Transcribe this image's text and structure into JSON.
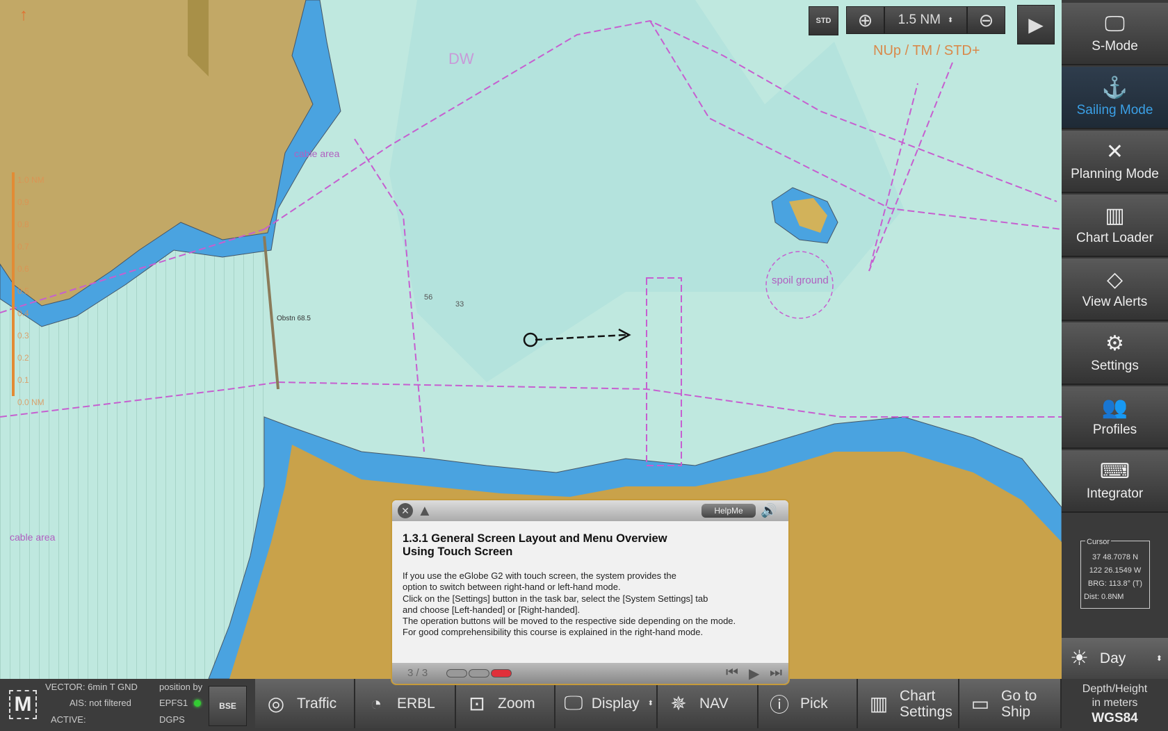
{
  "toolbar": {
    "chart_type": "STD",
    "range": "1.5 NM",
    "orientation_mode": "NUp / TM / STD+"
  },
  "map": {
    "range_scale": {
      "top": "1.0 NM",
      "ticks": [
        "0.9",
        "0.8",
        "0.7",
        "0.6",
        "0.5",
        "0.4",
        "0.3",
        "0.2",
        "0.1"
      ],
      "bottom": "0.0 NM"
    },
    "labels": {
      "cable_area_1": "cable area",
      "cable_area_2": "cable area",
      "spoil_ground": "spoil ground",
      "dw": "DW",
      "obstruction": "Obstn 68.5",
      "depth_1": "33",
      "depth_2": "56"
    }
  },
  "sidebar": {
    "items": [
      {
        "label": "S-Mode",
        "icon": "monitor-icon"
      },
      {
        "label": "Sailing Mode",
        "icon": "anchor-icon",
        "active": true
      },
      {
        "label": "Planning Mode",
        "icon": "tools-icon"
      },
      {
        "label": "Chart Loader",
        "icon": "chart-map-icon"
      },
      {
        "label": "View Alerts",
        "icon": "alert-diamond-icon"
      },
      {
        "label": "Settings",
        "icon": "gear-icon"
      },
      {
        "label": "Profiles",
        "icon": "users-icon"
      },
      {
        "label": "Integrator",
        "icon": "keyboard-icon"
      }
    ],
    "cursor": {
      "legend": "Cursor",
      "lat": "37 48.7078 N",
      "lon": "122 26.1549 W",
      "brg": "BRG:  113.8°  (T)",
      "dist": "Dist:  0.8NM"
    },
    "day": "Day",
    "depth_line1": "Depth/Height",
    "depth_line2": "in meters",
    "datum": "WGS84"
  },
  "bottom": {
    "logo": "M",
    "vector": "VECTOR: 6min T GND",
    "ais": "AIS: not filtered",
    "active": "ACTIVE:",
    "position_by": "position by",
    "epfs": "EPFS1",
    "dgps": "DGPS",
    "bse": "BSE",
    "buttons": [
      {
        "label": "Traffic"
      },
      {
        "label": "ERBL"
      },
      {
        "label": "Zoom"
      },
      {
        "label": "Display"
      },
      {
        "label": "NAV"
      },
      {
        "label": "Pick"
      },
      {
        "label": "Chart",
        "label2": "Settings"
      },
      {
        "label": "Go to",
        "label2": "Ship"
      }
    ]
  },
  "help": {
    "button": "HelpMe",
    "title1": "1.3.1 General Screen Layout and Menu Overview",
    "title2": "Using Touch Screen",
    "body": "If you use the eGlobe G2 with touch screen, the system provides the\noption to switch between right-hand or left-hand mode.\nClick on the [Settings] button in the task bar, select the [System Settings] tab\nand choose [Left-handed] or [Right-handed].\nThe operation buttons will be moved to the respective side depending on the mode.\nFor good comprehensibility this course is explained in the right-hand mode.",
    "page": "3 / 3",
    "progress_current": 3,
    "progress_total": 3
  },
  "colors": {
    "land": "#c9a24a",
    "shallow": "#4aa3e0",
    "water": "#bfe8df",
    "route": "#c65fd0",
    "active": "#3ba0e6",
    "progress": "#e0303a"
  }
}
